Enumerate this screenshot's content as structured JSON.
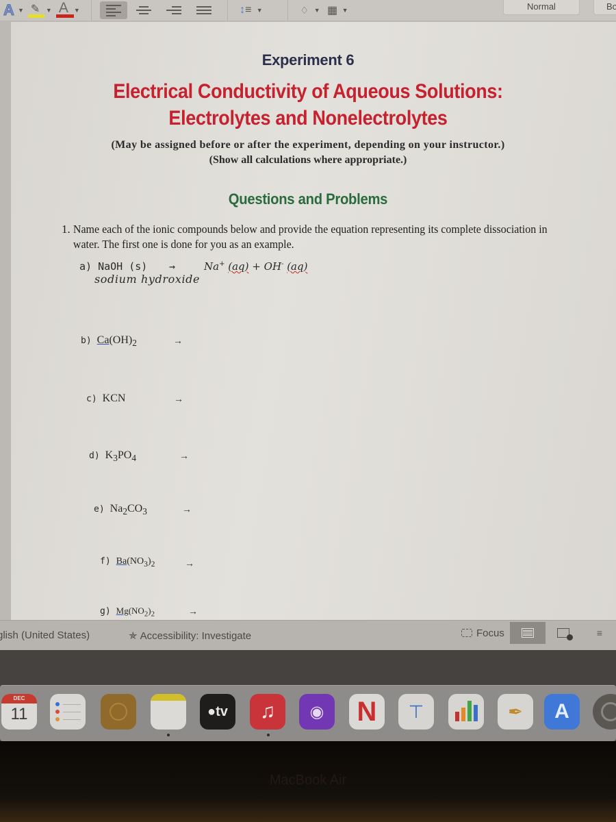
{
  "toolbar": {
    "font_color_letter": "A",
    "text_effects_letter": "A",
    "styles": [
      "Normal",
      "Body"
    ]
  },
  "document": {
    "experiment": "Experiment 6",
    "title_line1": "Electrical Conductivity of Aqueous Solutions:",
    "title_line2": "Electrolytes and Nonelectrolytes",
    "note1": "(May be assigned before or after the experiment, depending on your instructor.)",
    "note2": "(Show all calculations where appropriate.)",
    "section": "Questions and Problems",
    "question1": {
      "number": "1.",
      "text": "Name each of the ionic compounds below and provide the equation representing its complete dissociation in water. The first one is done for you as an example."
    },
    "example": {
      "label": "a) NaOH (s)",
      "arrow": "→",
      "product1": "Na",
      "charge1": "+",
      "state1": "(aq)",
      "plus": "+",
      "product2": "OH",
      "charge2": "-",
      "state2": "(aq)",
      "name": "sodium hydroxide"
    },
    "items": [
      {
        "label": "b)",
        "formula_a": "Ca",
        "formula_b": "(OH)",
        "sub": "2",
        "arrow": "→"
      },
      {
        "label": "c)",
        "formula_a": "KCN",
        "arrow": "→"
      },
      {
        "label": "d)",
        "formula_a": "K",
        "sub1": "3",
        "formula_b": "PO",
        "sub2": "4",
        "arrow": "→"
      },
      {
        "label": "e)",
        "formula_a": "Na",
        "sub1": "2",
        "formula_b": "CO",
        "sub2": "3",
        "arrow": "→"
      },
      {
        "label": "f)",
        "formula_a": "Ba",
        "formula_b": "(NO",
        "sub1": "3",
        "formula_c": ")",
        "sub2": "2",
        "arrow": "→"
      },
      {
        "label": "g)",
        "formula_a": "Mg",
        "formula_b": "(NO",
        "sub1": "2",
        "formula_c": ")",
        "sub2": "2",
        "arrow": "→"
      }
    ]
  },
  "status_bar": {
    "language": "glish (United States)",
    "accessibility": "Accessibility: Investigate",
    "focus": "Focus"
  },
  "dock": {
    "calendar_month": "DEC",
    "calendar_day": "11",
    "tv_label": "tv"
  },
  "bezel": {
    "brand": "MacBook Air"
  }
}
